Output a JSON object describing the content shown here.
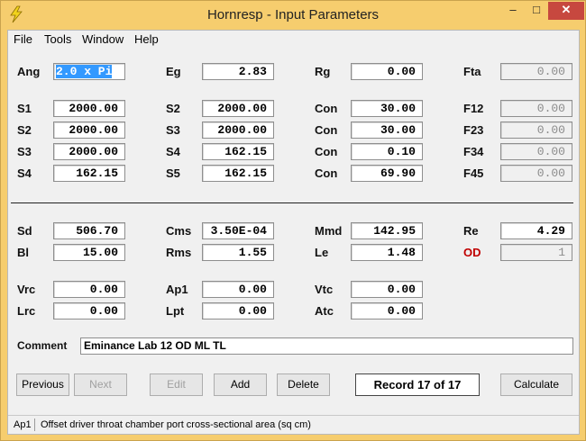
{
  "window": {
    "title": "Hornresp - Input Parameters"
  },
  "controls": {
    "minimize": "–",
    "maximize": "□",
    "close": "✕"
  },
  "menu": [
    "File",
    "Tools",
    "Window",
    "Help"
  ],
  "labels": {
    "ang": "Ang",
    "eg": "Eg",
    "rg": "Rg",
    "fta": "Fta",
    "s1": "S1",
    "s2": "S2",
    "s3": "S3",
    "s4": "S4",
    "s5": "S5",
    "con": "Con",
    "f12": "F12",
    "f23": "F23",
    "f34": "F34",
    "f45": "F45",
    "sd": "Sd",
    "cms": "Cms",
    "mmd": "Mmd",
    "re": "Re",
    "bl": "Bl",
    "rms": "Rms",
    "le": "Le",
    "od": "OD",
    "vrc": "Vrc",
    "ap1": "Ap1",
    "vtc": "Vtc",
    "lrc": "Lrc",
    "lpt": "Lpt",
    "atc": "Atc",
    "comment": "Comment"
  },
  "values": {
    "ang": "2.0 x Pi",
    "eg": "2.83",
    "rg": "0.00",
    "fta": "0.00",
    "row1_s1": "2000.00",
    "row1_s2": "2000.00",
    "row1_con": "30.00",
    "row1_f": "0.00",
    "row2_s2": "2000.00",
    "row2_s3": "2000.00",
    "row2_con": "30.00",
    "row2_f": "0.00",
    "row3_s3": "2000.00",
    "row3_s4": "162.15",
    "row3_con": "0.10",
    "row3_f": "0.00",
    "row4_s4": "162.15",
    "row4_s5": "162.15",
    "row4_con": "69.90",
    "row4_f": "0.00",
    "sd": "506.70",
    "cms": "3.50E-04",
    "mmd": "142.95",
    "re": "4.29",
    "bl": "15.00",
    "rms": "1.55",
    "le": "1.48",
    "od": "1",
    "vrc": "0.00",
    "ap1": "0.00",
    "vtc": "0.00",
    "lrc": "0.00",
    "lpt": "0.00",
    "atc": "0.00"
  },
  "comment_value": "Eminance Lab 12 OD ML TL",
  "buttons": {
    "previous": "Previous",
    "next": "Next",
    "edit": "Edit",
    "add": "Add",
    "delete": "Delete",
    "calculate": "Calculate"
  },
  "record": "Record 17 of 17",
  "status": {
    "key": "Ap1",
    "text": "Offset driver throat chamber port cross-sectional area  (sq cm)"
  },
  "colors": {
    "titlebar": "#f6cd6e",
    "selection": "#3399ff",
    "od_label": "#c00000",
    "close_button": "#c7483f"
  }
}
